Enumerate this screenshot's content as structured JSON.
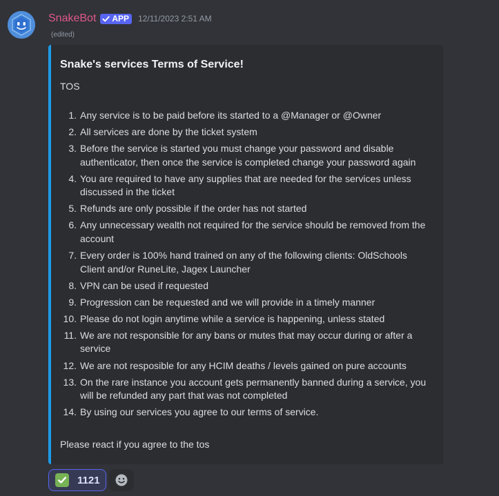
{
  "message": {
    "author": "SnakeBot",
    "app_tag": "APP",
    "timestamp": "12/11/2023 2:51 AM",
    "edited": "(edited)",
    "avatar_icon": "robot-face-icon"
  },
  "embed": {
    "accent_color": "#1c9be7",
    "title": "Snake's services Terms of Service!",
    "subtitle": "TOS",
    "items": [
      {
        "num": "1.",
        "text": "Any service is to be paid before its started to a @Manager or @Owner"
      },
      {
        "num": "2.",
        "text": "All services are done by the ticket system"
      },
      {
        "num": "3.",
        "text": "Before the service is started you must change your password and disable authenticator, then once the service is completed change your password again"
      },
      {
        "num": "4.",
        "text": "You are required to have any supplies that are needed for the services unless discussed in the ticket"
      },
      {
        "num": "5.",
        "text": "Refunds are only possible if the order has not started"
      },
      {
        "num": "6.",
        "text": "Any unnecessary wealth not required for the service should be removed from the account"
      },
      {
        "num": "7.",
        "text": "Every order is 100% hand trained on any of the following clients: OldSchools Client and/or RuneLite, Jagex Launcher"
      },
      {
        "num": "8.",
        "text": "VPN can be used if requested"
      },
      {
        "num": "9.",
        "text": "Progression can be requested and we will provide in a timely manner"
      },
      {
        "num": "10.",
        "text": "Please do not login anytime while a service is happening, unless stated"
      },
      {
        "num": "11.",
        "text": "We are not responsible for any bans or mutes that may occur during or after a service"
      },
      {
        "num": "12.",
        "text": "We are not resposible for any HCIM deaths / levels gained on pure accounts"
      },
      {
        "num": "13.",
        "text": "On the rare instance you account gets permanently banned during a service, you will be refunded any part that was not completed"
      },
      {
        "num": "14.",
        "text": "By using our services you agree to our terms of service."
      }
    ],
    "footer": "Please react if you agree to the tos"
  },
  "reactions": [
    {
      "emoji": "check-mark-button-icon",
      "count": "1121",
      "selected": true
    }
  ],
  "add_reaction_icon": "add-reaction-smiley-icon",
  "colors": {
    "background": "#313338",
    "embed_bg": "#2b2d31",
    "username": "#e0588a",
    "app_tag": "#5865f2",
    "reaction_border": "#5865f2"
  }
}
